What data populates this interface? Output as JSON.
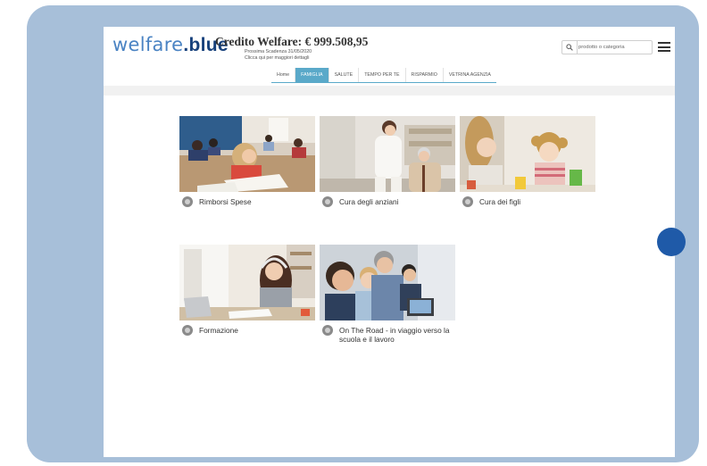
{
  "brand": {
    "logo_part1": "welfare",
    "logo_part2": ".blue"
  },
  "credit": {
    "title": "Credito Welfare: € 999.508,95",
    "deadline": "Prossima Scadenza 31/05/2020",
    "details_link": "Clicca qui per maggiori dettagli"
  },
  "search": {
    "placeholder": "prodotto o categoria"
  },
  "nav": {
    "tabs": [
      {
        "label": "Home"
      },
      {
        "label": "FAMIGLIA"
      },
      {
        "label": "SALUTE"
      },
      {
        "label": "TEMPO PER TE"
      },
      {
        "label": "RISPARMIO"
      },
      {
        "label": "VETRINA AGENZIA"
      }
    ],
    "active": "FAMIGLIA"
  },
  "categories": [
    {
      "label": "Rimborsi Spese",
      "icon": "coins-icon"
    },
    {
      "label": "Cura degli anziani",
      "icon": "elderly-care-icon"
    },
    {
      "label": "Cura dei figli",
      "icon": "child-care-icon"
    },
    {
      "label": "Formazione",
      "icon": "education-icon"
    },
    {
      "label": "On The Road - in viaggio verso la scuola e il lavoro",
      "icon": "car-icon"
    }
  ],
  "colors": {
    "tablet_frame": "#a7bfd9",
    "home_button": "#1f5aa8",
    "brand_dark": "#17417c",
    "brand_light": "#4a83c3",
    "active_tab": "#5aa9c9"
  }
}
